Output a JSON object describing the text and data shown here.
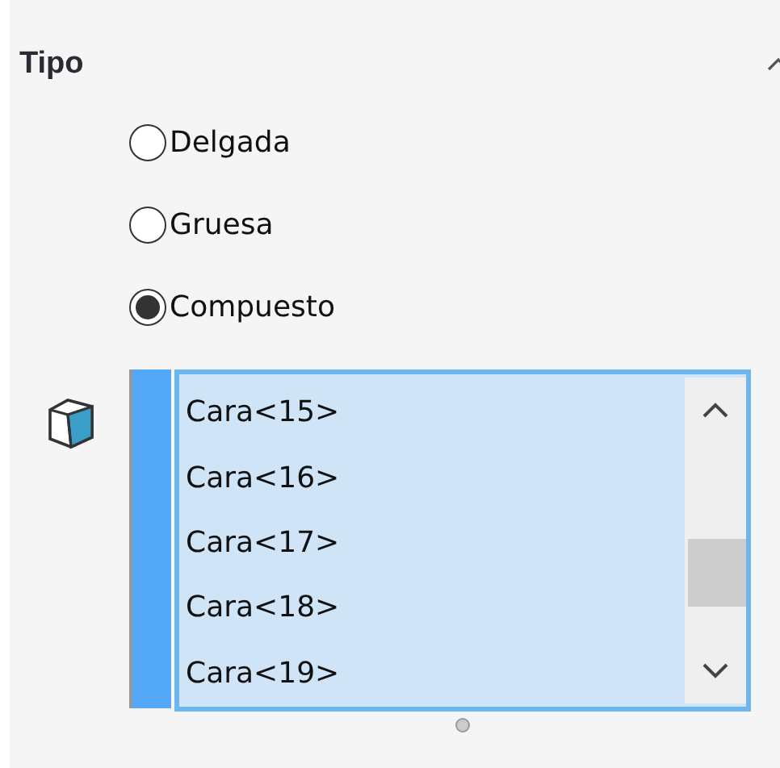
{
  "section": {
    "title": "Tipo",
    "expanded": true
  },
  "options": [
    {
      "label": "Delgada",
      "selected": false
    },
    {
      "label": "Gruesa",
      "selected": false
    },
    {
      "label": "Compuesto",
      "selected": true
    }
  ],
  "faces": {
    "items": [
      "Cara<15>",
      "Cara<16>",
      "Cara<17>",
      "Cara<18>",
      "Cara<19>"
    ]
  }
}
